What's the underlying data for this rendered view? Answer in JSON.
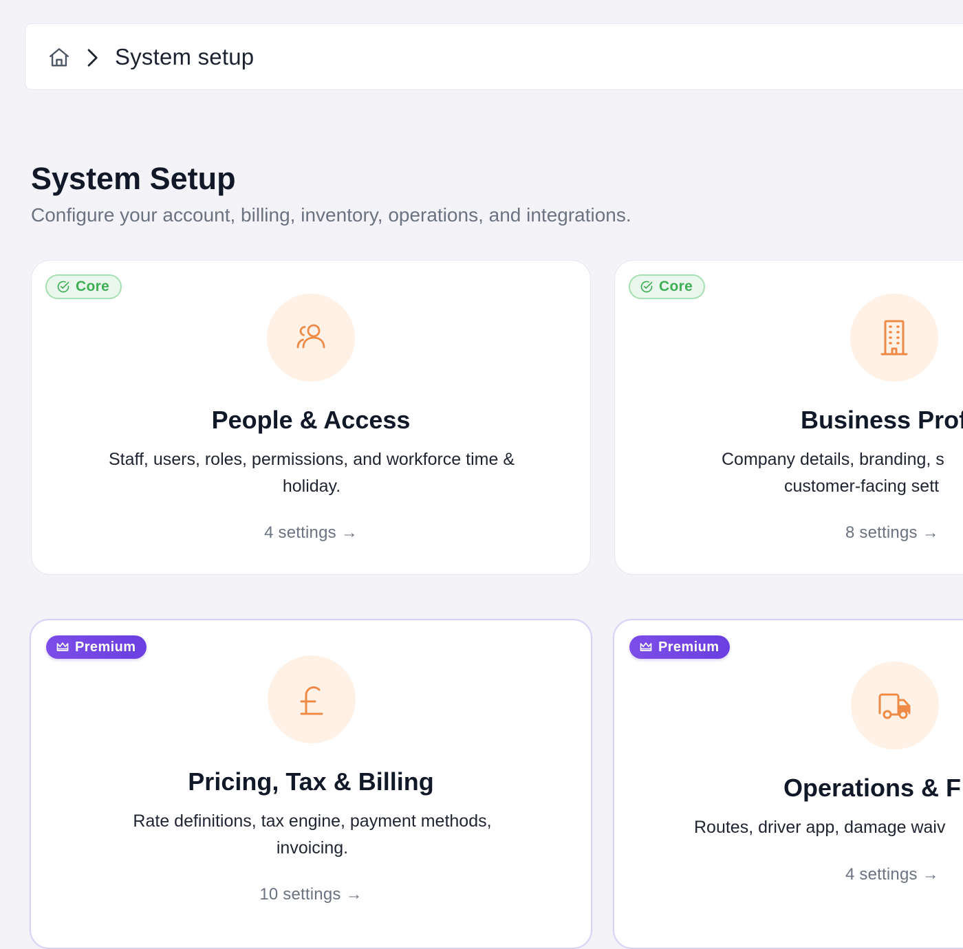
{
  "breadcrumb": {
    "home_icon": "home-icon",
    "separator_icon": "chevron-right-icon",
    "current": "System setup"
  },
  "header": {
    "title": "System Setup",
    "subtitle": "Configure your account, billing, inventory, operations, and integrations."
  },
  "colors": {
    "accent_orange": "#ee8a45",
    "icon_bg": "#fff1e6",
    "core_green": "#3fae57",
    "premium_purple": "#6a3fe0"
  },
  "cards": [
    {
      "badge": "Core",
      "badge_icon": "check-circle-icon",
      "icon": "users-icon",
      "title": "People & Access",
      "description": "Staff, users, roles, permissions, and workforce time & holiday.",
      "link": "4 settings →"
    },
    {
      "badge": "Core",
      "badge_icon": "check-circle-icon",
      "icon": "building-icon",
      "title": "Business Profi",
      "description_line1": "Company details, branding, s",
      "description_line2": "customer-facing sett",
      "link": "8 settings →"
    },
    {
      "badge": "Premium",
      "badge_icon": "crown-icon",
      "icon": "pound-icon",
      "title": "Pricing, Tax & Billing",
      "description": "Rate definitions, tax engine, payment methods, invoicing.",
      "link": "10 settings →"
    },
    {
      "badge": "Premium",
      "badge_icon": "crown-icon",
      "icon": "truck-icon",
      "title": "Operations & F",
      "description": "Routes, driver app, damage waiv",
      "link": "4 settings →"
    }
  ]
}
